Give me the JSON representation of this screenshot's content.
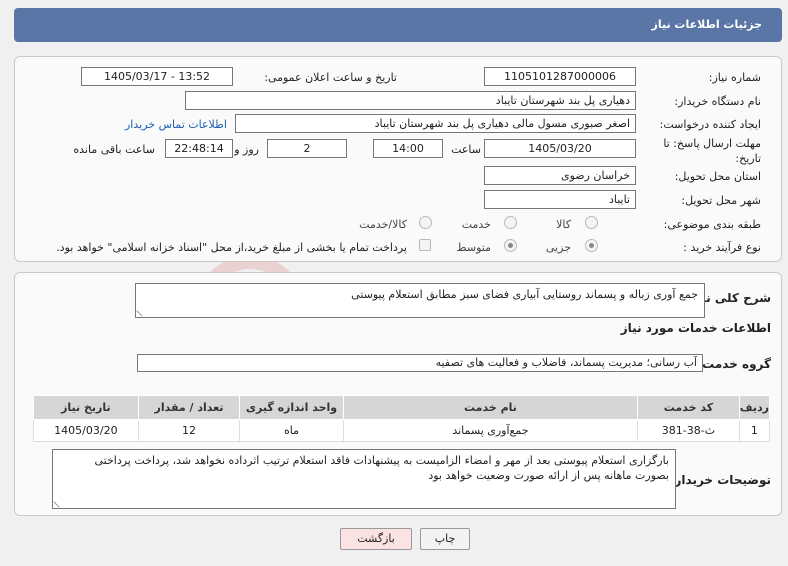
{
  "header": {
    "title": "جزئیات اطلاعات نیاز"
  },
  "form": {
    "need_number_label": "شماره نیاز:",
    "need_number": "1105101287000006",
    "announce_label": "تاریخ و ساعت اعلان عمومی:",
    "announce_value": "1405/03/17 - 13:52",
    "buyer_label": "نام دستگاه خریدار:",
    "buyer_value": "دهیاری پل بند  شهرستان تایباد",
    "creator_label": "ایجاد کننده درخواست:",
    "creator_value": "اصغر صبوری مسول مالی دهیاری پل بند  شهرستان تایباد",
    "contact_link": "اطلاعات تماس خریدار",
    "deadline_label_1": "مهلت ارسال پاسخ: تا",
    "deadline_label_2": "تاریخ:",
    "deadline_date": "1405/03/20",
    "time_label": "ساعت",
    "deadline_time": "14:00",
    "days_value": "2",
    "days_label": "روز و",
    "remaining_time": "22:48:14",
    "remaining_label": "ساعت باقی مانده",
    "province_label": "استان محل تحویل:",
    "province_value": "خراسان رضوی",
    "city_label": "شهر محل تحویل:",
    "city_value": "تایباد",
    "category_label": "طبقه بندی موضوعی:",
    "category_options": [
      "کالا",
      "خدمت",
      "کالا/خدمت"
    ],
    "purchase_type_label": "نوع فرآیند خرید :",
    "purchase_options": [
      "جزیی",
      "متوسط"
    ],
    "payment_note": "پرداخت تمام یا بخشی از مبلغ خرید،از محل \"اسناد خزانه اسلامی\" خواهد بود."
  },
  "details": {
    "summary_label": "شرح کلی نیاز:",
    "summary_value": "جمع آوری زباله و پسماند روستایی آبیاری فضای سبز مطابق استعلام پیوستی",
    "services_title": "اطلاعات خدمات مورد نیاز",
    "service_group_label": "گروه خدمت:",
    "service_group_value": "آب رسانی؛ مدیریت پسماند، فاضلاب و فعالیت های تصفیه",
    "table_headers": [
      "ردیف",
      "کد خدمت",
      "نام خدمت",
      "واحد اندازه گیری",
      "تعداد / مقدار",
      "تاریخ نیاز"
    ],
    "table_rows": [
      [
        "1",
        "ث-38-381",
        "جمع‌آوری پسماند",
        "ماه",
        "12",
        "1405/03/20"
      ]
    ],
    "buyer_notes_label": "توضیحات خریدار:",
    "buyer_notes_value": "بارگزاری  استعلام پیوستی بعد از مهر و امضاء الزامیست به پیشنهادات فاقد استعلام ترتیب اثرداده نخواهد شد، پرداخت پرداختی  بصورت ماهانه پس از ارائه صورت وضعیت خواهد بود"
  },
  "buttons": {
    "print": "چاپ",
    "back": "بازگشت"
  },
  "watermark_text": "AriaTender.neT",
  "colors": {
    "header": "#5a76a6",
    "link": "#1a5fb4",
    "back_button": "#fbe3e4"
  }
}
